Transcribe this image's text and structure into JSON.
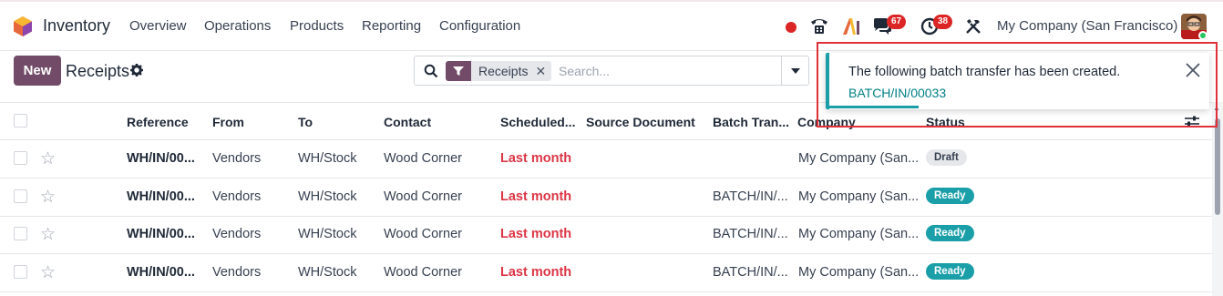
{
  "navbar": {
    "app_name": "Inventory",
    "menu": [
      "Overview",
      "Operations",
      "Products",
      "Reporting",
      "Configuration"
    ],
    "chat_count": "67",
    "activity_count": "38",
    "company": "My Company (San Francisco)"
  },
  "control": {
    "new_label": "New",
    "title": "Receipts",
    "facet_label": "Receipts",
    "search_placeholder": "Search..."
  },
  "table": {
    "headers": [
      "Reference",
      "From",
      "To",
      "Contact",
      "Scheduled...",
      "Source Document",
      "Batch Tran...",
      "Company",
      "Status"
    ],
    "rows": [
      {
        "reference": "WH/IN/00...",
        "from": "Vendors",
        "to": "WH/Stock",
        "contact": "Wood Corner",
        "scheduled": "Last month",
        "source": "",
        "batch": "",
        "company": "My Company (San...",
        "status": "Draft"
      },
      {
        "reference": "WH/IN/00...",
        "from": "Vendors",
        "to": "WH/Stock",
        "contact": "Wood Corner",
        "scheduled": "Last month",
        "source": "",
        "batch": "BATCH/IN/...",
        "company": "My Company (San...",
        "status": "Ready"
      },
      {
        "reference": "WH/IN/00...",
        "from": "Vendors",
        "to": "WH/Stock",
        "contact": "Wood Corner",
        "scheduled": "Last month",
        "source": "",
        "batch": "BATCH/IN/...",
        "company": "My Company (San...",
        "status": "Ready"
      },
      {
        "reference": "WH/IN/00...",
        "from": "Vendors",
        "to": "WH/Stock",
        "contact": "Wood Corner",
        "scheduled": "Last month",
        "source": "",
        "batch": "BATCH/IN/...",
        "company": "My Company (San...",
        "status": "Ready"
      }
    ]
  },
  "notification": {
    "message": "The following batch transfer has been created.",
    "link": "BATCH/IN/00033"
  },
  "colors": {
    "brand": "#714b67",
    "ready": "#1a9fa8",
    "late": "#dc3545",
    "highlight": "#e0303a"
  }
}
